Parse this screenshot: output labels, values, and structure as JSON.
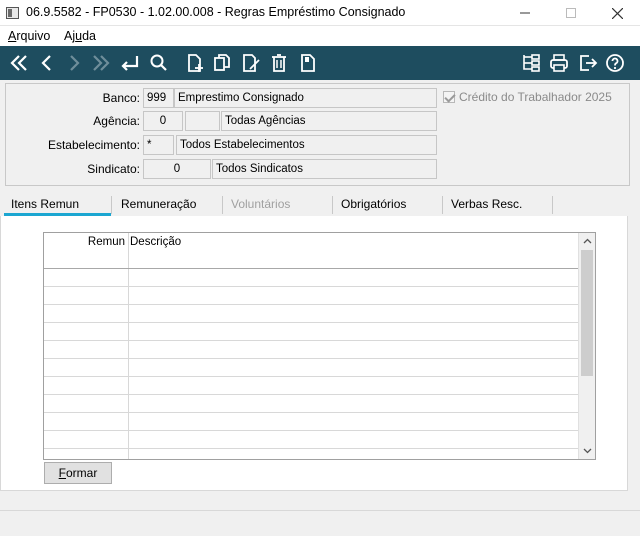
{
  "window": {
    "title": "06.9.5582 - FP0530 - 1.02.00.008 - Regras Empréstimo Consignado"
  },
  "menu": {
    "arquivo_pre": "",
    "arquivo_u": "A",
    "arquivo_post": "rquivo",
    "ajuda_pre": "Aj",
    "ajuda_u": "u",
    "ajuda_post": "da"
  },
  "toolbar": {
    "background": "#1e4d5f",
    "icons": [
      "first-icon",
      "previous-icon",
      "next-icon",
      "last-icon",
      "enter-icon",
      "search-icon",
      "new-document-icon",
      "copy-icon",
      "edit-icon",
      "delete-icon",
      "paste-icon",
      "tree-icon",
      "print-icon",
      "exit-icon",
      "help-icon"
    ]
  },
  "form": {
    "banco_label": "Banco:",
    "banco_code": "999",
    "banco_name": "Emprestimo Consignado",
    "agencia_label": "Agência:",
    "agencia_code": "0",
    "agencia_digit": "",
    "agencia_name": "Todas Agências",
    "estab_label": "Estabelecimento:",
    "estab_code": "*",
    "estab_name": "Todos Estabelecimentos",
    "sindicato_label": "Sindicato:",
    "sindicato_code": "0",
    "sindicato_name": "Todos Sindicatos",
    "credito_label": "Crédito do Trabalhador 2025",
    "credito_checked": true
  },
  "tabs": [
    {
      "label": "Itens Remun",
      "state": "active"
    },
    {
      "label": "Remuneração",
      "state": "normal"
    },
    {
      "label": "Voluntários",
      "state": "disabled"
    },
    {
      "label": "Obrigatórios",
      "state": "normal"
    },
    {
      "label": "Verbas Resc.",
      "state": "normal"
    }
  ],
  "grid": {
    "columns": [
      "Remun",
      "Descrição"
    ],
    "rows": [
      [
        "",
        ""
      ],
      [
        "",
        ""
      ],
      [
        "",
        ""
      ],
      [
        "",
        ""
      ],
      [
        "",
        ""
      ],
      [
        "",
        ""
      ],
      [
        "",
        ""
      ],
      [
        "",
        ""
      ],
      [
        "",
        ""
      ],
      [
        "",
        ""
      ]
    ]
  },
  "buttons": {
    "formar_u": "F",
    "formar_post": "ormar"
  },
  "colors": {
    "active_tab": "#1ba6d1"
  }
}
